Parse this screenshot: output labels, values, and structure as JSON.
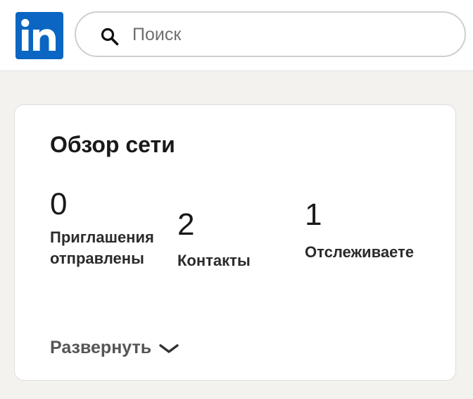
{
  "header": {
    "logo_text": "in",
    "search": {
      "placeholder": "Поиск",
      "value": ""
    }
  },
  "network_card": {
    "title": "Обзор сети",
    "stats": [
      {
        "value": "0",
        "label": "Приглашения отправлены"
      },
      {
        "value": "2",
        "label": "Контакты"
      },
      {
        "value": "1",
        "label": "Отслеживаете"
      }
    ],
    "expand_label": "Развернуть"
  },
  "colors": {
    "brand": "#0a66c2",
    "page_background": "#f3f2ef",
    "card_background": "#ffffff"
  },
  "icons": [
    "linkedin-logo-icon",
    "search-icon",
    "chevron-down-icon"
  ]
}
